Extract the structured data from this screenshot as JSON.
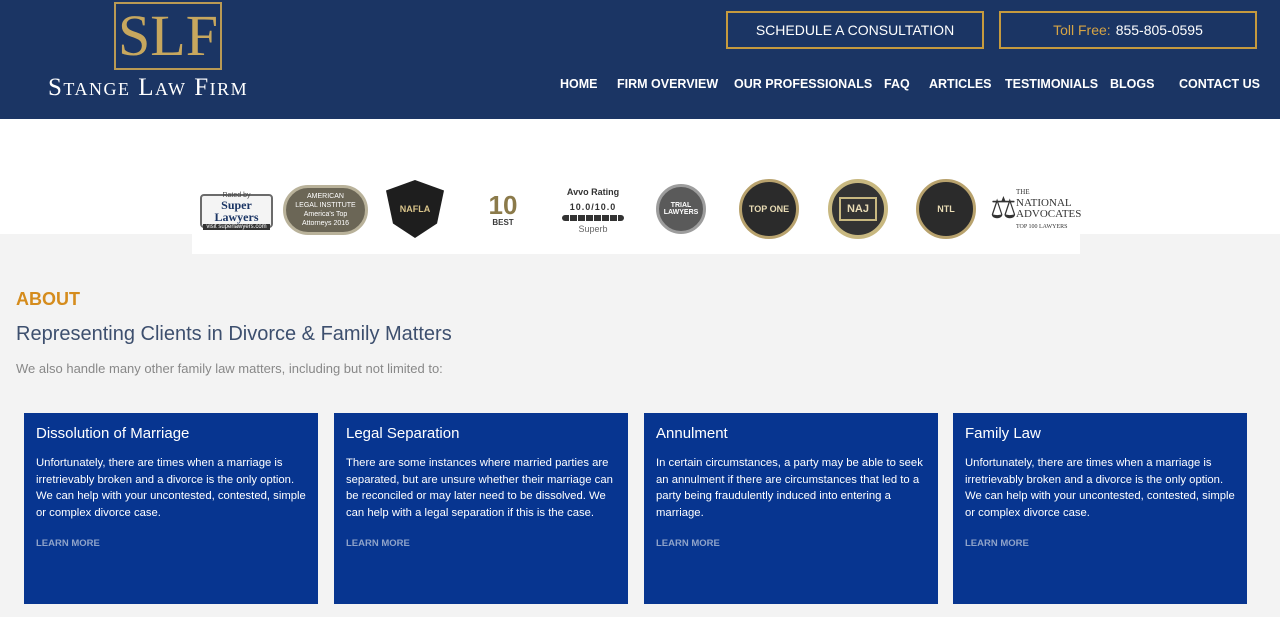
{
  "header": {
    "logo_mark": "SLF",
    "logo_name": "Stange Law Firm",
    "consult_button": "SCHEDULE A CONSULTATION",
    "toll_label": "Toll Free:",
    "toll_number": "855-805-0595",
    "nav": [
      "HOME",
      "FIRM OVERVIEW",
      "OUR PROFESSIONALS",
      "FAQ",
      "ARTICLES",
      "TESTIMONIALS",
      "BLOGS",
      "CONTACT US"
    ]
  },
  "badges": {
    "super_lawyers": {
      "line1": "Rated by",
      "line2": "Super Lawyers",
      "line3": "visit superlawyers.com"
    },
    "ali": {
      "line1": "AMERICAN",
      "line2": "LEGAL INSTITUTE",
      "line3": "America's Top",
      "line4": "Attorneys 2016"
    },
    "nafla": "NAFLA",
    "ten_best": {
      "num": "10",
      "word": "BEST"
    },
    "avvo": {
      "name": "Avvo Rating",
      "score": "10.0/10.0",
      "label": "Superb"
    },
    "trial": "TRIAL LAWYERS",
    "top_one": "TOP ONE",
    "naj": "NAJ",
    "ntl": "NTL",
    "national_advocates": {
      "line1": "THE",
      "line2": "NATIONAL",
      "line3": "ADVOCATES",
      "line4": "TOP 100 LAWYERS"
    }
  },
  "about": {
    "label": "ABOUT",
    "title": "Representing Clients in Divorce & Family Matters",
    "subtitle": "We also handle many other family law matters, including but not limited to:"
  },
  "cards": [
    {
      "title": "Dissolution of Marriage",
      "body": "Unfortunately, there are times when a marriage is irretrievably broken and a divorce is the only option. We can help with your uncontested, contested, simple or complex divorce case.",
      "link": "LEARN MORE"
    },
    {
      "title": "Legal Separation",
      "body": "There are some instances where married parties are separated, but are unsure whether their marriage can be reconciled or may later need to be dissolved. We can help with a legal separation if this is the case.",
      "link": "LEARN MORE"
    },
    {
      "title": "Annulment",
      "body": "In certain circumstances, a party may be able to seek an annulment if there are circumstances that led to a party being fraudulently induced into entering a marriage.",
      "link": "LEARN MORE"
    },
    {
      "title": "Family Law",
      "body": "Unfortunately, there are times when a marriage is irretrievably broken and a divorce is the only option. We can help with your uncontested, contested, simple or complex divorce case.",
      "link": "LEARN MORE"
    }
  ]
}
